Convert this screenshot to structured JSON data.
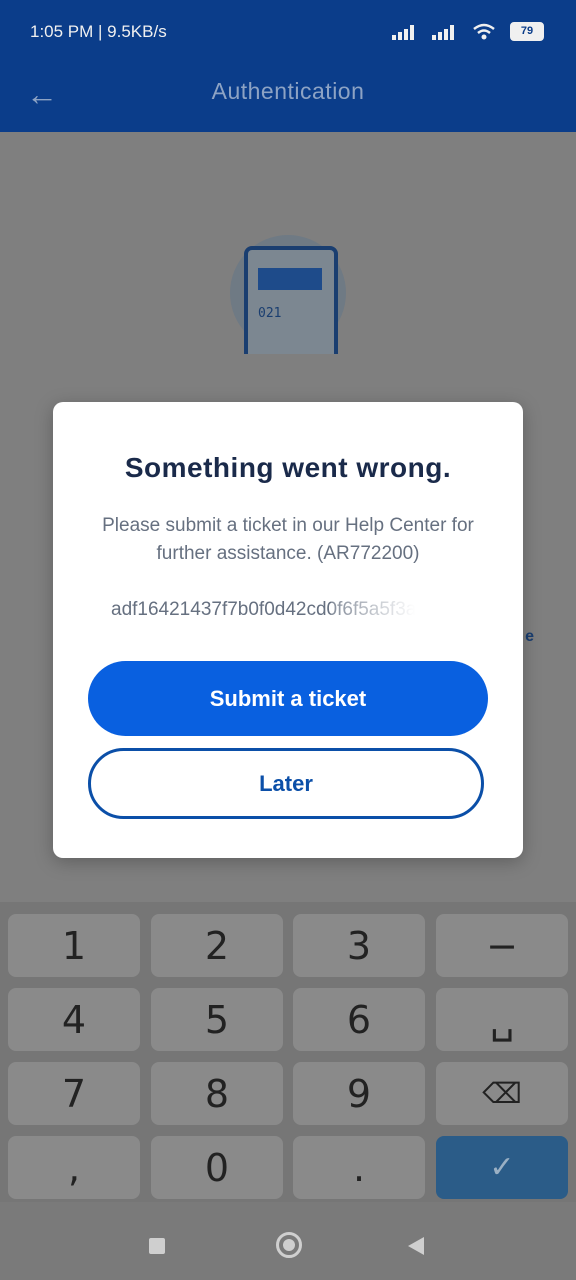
{
  "status_bar": {
    "time_speed": "1:05 PM | 9.5KB/s",
    "battery": "79"
  },
  "app_bar": {
    "title": "Authentication",
    "back_icon": "arrow-left-icon"
  },
  "illustration": {
    "code": "021"
  },
  "dialog": {
    "title": "Something went wrong.",
    "message": "Please submit a ticket in our Help Center for further assistance. (AR772200)",
    "trace_id": "adf16421437f7b0f0d42cd0f6f5a5f3a",
    "primary_button": "Submit a ticket",
    "secondary_button": "Later"
  },
  "side_link": "e",
  "keyboard": {
    "keys": [
      "1",
      "2",
      "3",
      "−",
      "4",
      "5",
      "6",
      "␣",
      "7",
      "8",
      "9",
      "⌫",
      ",",
      "0",
      ".",
      "✓"
    ]
  },
  "colors": {
    "primary": "#0960e0",
    "header": "#0b3d8a"
  }
}
